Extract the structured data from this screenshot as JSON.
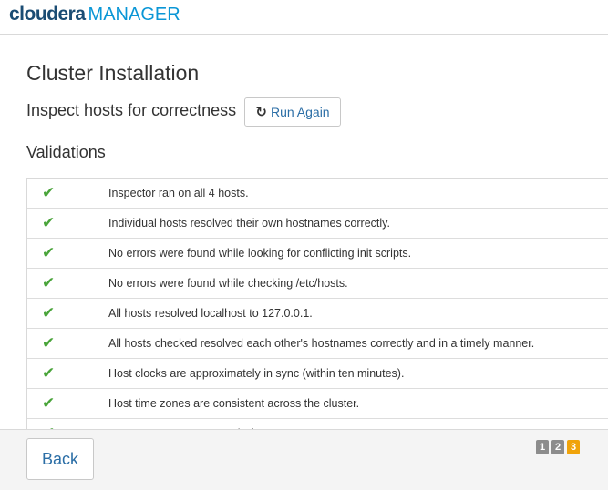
{
  "header": {
    "brand": "cloudera",
    "product": "MANAGER"
  },
  "page": {
    "title": "Cluster Installation",
    "subtitle": "Inspect hosts for correctness",
    "run_again_label": "Run Again",
    "validations_title": "Validations"
  },
  "validations": [
    {
      "status": "ok",
      "message": "Inspector ran on all 4 hosts."
    },
    {
      "status": "ok",
      "message": "Individual hosts resolved their own hostnames correctly."
    },
    {
      "status": "ok",
      "message": "No errors were found while looking for conflicting init scripts."
    },
    {
      "status": "ok",
      "message": "No errors were found while checking /etc/hosts."
    },
    {
      "status": "ok",
      "message": "All hosts resolved localhost to 127.0.0.1."
    },
    {
      "status": "ok",
      "message": "All hosts checked resolved each other's hostnames correctly and in a timely manner."
    },
    {
      "status": "ok",
      "message": "Host clocks are approximately in sync (within ten minutes)."
    },
    {
      "status": "ok",
      "message": "Host time zones are consistent across the cluster."
    },
    {
      "status": "ok",
      "message": "No users or groups are missing."
    }
  ],
  "footer": {
    "back_label": "Back",
    "steps": [
      "1",
      "2",
      "3"
    ],
    "current_step": 3
  },
  "colors": {
    "check": "#49a43a",
    "accent": "#2b6ea6",
    "step_current": "#f0a30a",
    "step_done": "#8c8c8c"
  }
}
